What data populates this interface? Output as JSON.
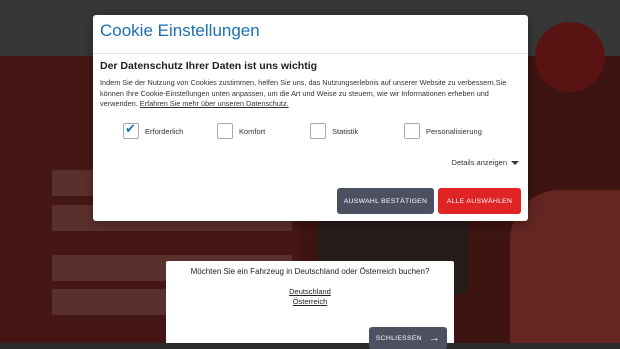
{
  "cookie": {
    "title": "Cookie Einstellungen",
    "subtitle": "Der Datenschutz Ihrer Daten ist uns wichtig",
    "description": "Indem Sie der Nutzung von Cookies zustimmen, helfen Sie uns, das Nutzungserlebnis auf unserer Website zu verbessern.Sie können Ihre Cookie-Einstellungen unten anpassen, um die Art und Weise zu steuern, wie wir Informationen erheben und verwenden.",
    "privacy_link": "Erfahren Sie mehr über unseren Datenschutz.",
    "options": [
      {
        "label": "Erforderlich",
        "checked": true
      },
      {
        "label": "Komfort",
        "checked": false
      },
      {
        "label": "Statistik",
        "checked": false
      },
      {
        "label": "Personalisierung",
        "checked": false
      }
    ],
    "details_label": "Details anzeigen",
    "confirm_button": "AUSWAHL BESTÄTIGEN",
    "select_all_button": "ALLE AUSWÄHLEN",
    "accent_color": "#1c6fb0",
    "primary_color": "#e02425"
  },
  "country": {
    "question": "Möchten Sie ein Fahrzeug in Deutschland oder Österreich buchen?",
    "option_de": "Deutschland",
    "option_at": "Österreich",
    "close_button": "SCHLIESSEN"
  }
}
